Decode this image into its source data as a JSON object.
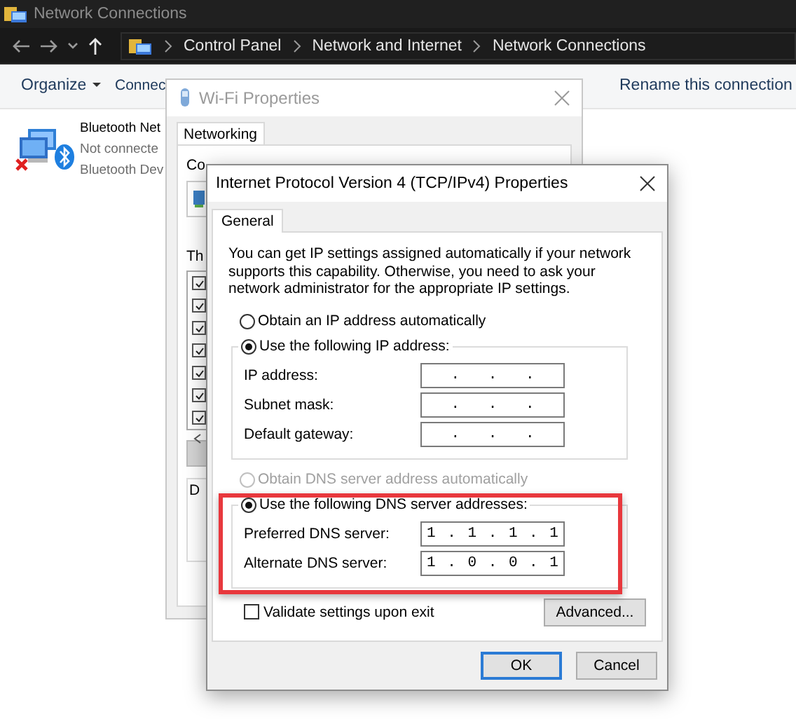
{
  "window": {
    "title": "Network Connections"
  },
  "address_bar": {
    "crumbs": [
      "Control Panel",
      "Network and Internet",
      "Network Connections"
    ]
  },
  "toolbar": {
    "items": [
      {
        "label": "Organize",
        "kind": "menu"
      },
      {
        "label": "Connec",
        "kind": "plain"
      },
      {
        "label": "Rename this connection",
        "kind": "plain"
      }
    ]
  },
  "connections": [
    {
      "name": "Bluetooth Net",
      "status": "Not connecte",
      "device": "Bluetooth Dev",
      "disconnected": true
    }
  ],
  "wifi_dialog": {
    "title": "Wi-Fi Properties",
    "active": false,
    "tabs": [
      {
        "label": "Networking",
        "selected": true
      }
    ],
    "connect_label": "Co",
    "components_label": "Th",
    "description_label": "D",
    "components": [
      {
        "checked": true
      },
      {
        "checked": true
      },
      {
        "checked": true
      },
      {
        "checked": true
      },
      {
        "checked": true
      },
      {
        "checked": true
      },
      {
        "checked": true
      }
    ]
  },
  "ipv4_dialog": {
    "title": "Internet Protocol Version 4 (TCP/IPv4) Properties",
    "active": true,
    "tabs": [
      {
        "label": "General",
        "selected": true
      }
    ],
    "intro": "You can get IP settings assigned automatically if your network supports this capability. Otherwise, you need to ask your network administrator for the appropriate IP settings.",
    "ip_mode": [
      {
        "label": "Obtain an IP address automatically",
        "selected": false,
        "disabled": false
      },
      {
        "label": "Use the following IP address:",
        "selected": true,
        "disabled": false
      }
    ],
    "ip_fields": [
      {
        "label": "IP address:",
        "value": ". . ."
      },
      {
        "label": "Subnet mask:",
        "value": ". . ."
      },
      {
        "label": "Default gateway:",
        "value": ". . ."
      }
    ],
    "dns_mode": [
      {
        "label": "Obtain DNS server address automatically",
        "selected": false,
        "disabled": true
      },
      {
        "label": "Use the following DNS server addresses:",
        "selected": true,
        "disabled": false
      }
    ],
    "dns_fields": [
      {
        "label": "Preferred DNS server:",
        "value": "1 . 1 . 1 . 1"
      },
      {
        "label": "Alternate DNS server:",
        "value": "1 . 0 . 0 . 1"
      }
    ],
    "highlight": {
      "kind": "frame"
    },
    "validate": {
      "label": "Validate settings upon exit",
      "checked": false
    },
    "advanced_button": "Advanced...",
    "buttons": [
      {
        "label": "OK",
        "default": true
      },
      {
        "label": "Cancel",
        "default": false
      }
    ]
  }
}
